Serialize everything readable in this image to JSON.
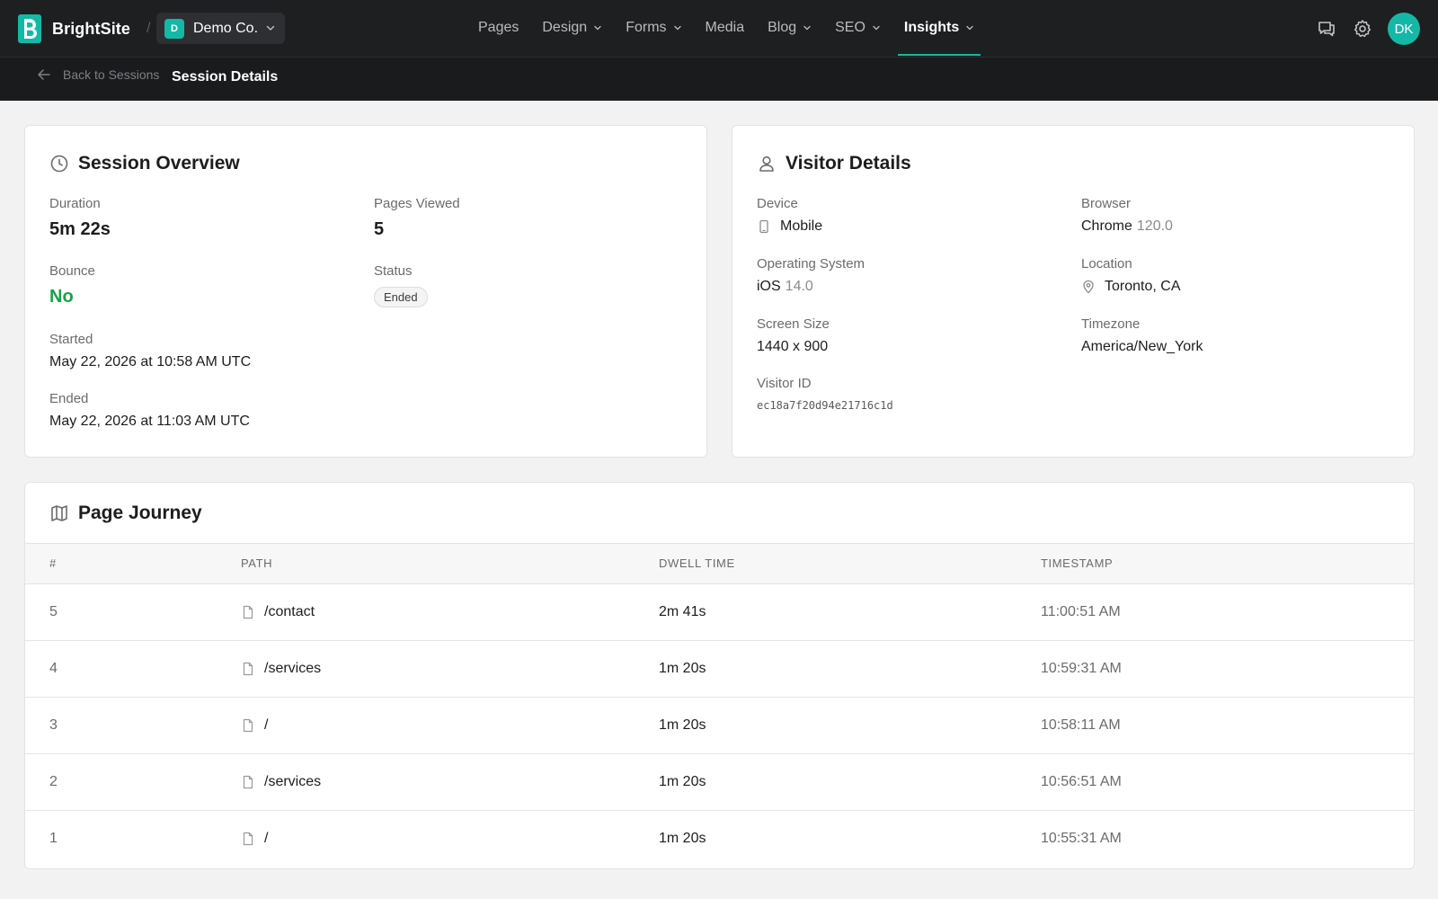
{
  "app": {
    "brand_name": "BrightSite",
    "separator": "/",
    "workspace_initial": "D",
    "workspace_name": "Demo Co."
  },
  "nav": {
    "items": [
      {
        "label": "Pages",
        "has_menu": false,
        "active": false
      },
      {
        "label": "Design",
        "has_menu": true,
        "active": false
      },
      {
        "label": "Forms",
        "has_menu": true,
        "active": false
      },
      {
        "label": "Media",
        "has_menu": false,
        "active": false
      },
      {
        "label": "Blog",
        "has_menu": true,
        "active": false
      },
      {
        "label": "SEO",
        "has_menu": true,
        "active": false
      },
      {
        "label": "Insights",
        "has_menu": true,
        "active": true
      }
    ]
  },
  "header": {
    "icons": [
      "chat-icon",
      "gear-icon"
    ],
    "avatar_initials": "DK"
  },
  "breadcrumb": {
    "back_label": "Back to Sessions",
    "current": "Session Details"
  },
  "session_overview": {
    "title": "Session Overview",
    "duration_label": "Duration",
    "duration": "5m 22s",
    "pages_viewed_label": "Pages Viewed",
    "pages_viewed": "5",
    "bounce_label": "Bounce",
    "bounce": "No",
    "status_label": "Status",
    "status": "Ended",
    "started_label": "Started",
    "started": "May 22, 2026 at 10:58 AM UTC",
    "ended_label": "Ended",
    "ended": "May 22, 2026 at 11:03 AM UTC"
  },
  "visitor_details": {
    "title": "Visitor Details",
    "device_label": "Device",
    "device": "Mobile",
    "browser_label": "Browser",
    "browser_name": "Chrome",
    "browser_version": "120.0",
    "os_label": "Operating System",
    "os_name": "iOS",
    "os_version": "14.0",
    "location_label": "Location",
    "location": "Toronto, CA",
    "screen_label": "Screen Size",
    "screen": "1440 x 900",
    "timezone_label": "Timezone",
    "timezone": "America/New_York",
    "visitor_id_label": "Visitor ID",
    "visitor_id": "ec18a7f20d94e21716c1d"
  },
  "page_journey": {
    "title": "Page Journey",
    "columns": [
      "#",
      "PATH",
      "DWELL TIME",
      "TIMESTAMP"
    ],
    "rows": [
      {
        "num": "5",
        "path": "/contact",
        "dwell": "2m 41s",
        "timestamp": "11:00:51 AM"
      },
      {
        "num": "4",
        "path": "/services",
        "dwell": "1m 20s",
        "timestamp": "10:59:31 AM"
      },
      {
        "num": "3",
        "path": "/",
        "dwell": "1m 20s",
        "timestamp": "10:58:11 AM"
      },
      {
        "num": "2",
        "path": "/services",
        "dwell": "1m 20s",
        "timestamp": "10:56:51 AM"
      },
      {
        "num": "1",
        "path": "/",
        "dwell": "1m 20s",
        "timestamp": "10:55:31 AM"
      }
    ]
  },
  "colors": {
    "accent": "#14b8a6",
    "header_bg": "#1e1f21",
    "success": "#15a34a"
  }
}
